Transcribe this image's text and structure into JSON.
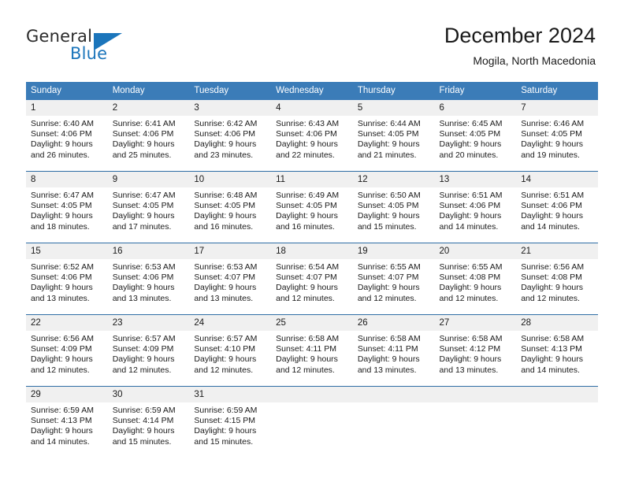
{
  "brand": {
    "name_part1": "General",
    "name_part2": "Blue",
    "logo_icon": "triangle-flag-icon",
    "accent_color": "#1b75bb"
  },
  "header": {
    "title": "December 2024",
    "subtitle": "Mogila, North Macedonia"
  },
  "theme": {
    "header_blue": "#3b7cb8",
    "row_border_blue": "#2f6ea5",
    "daynum_band": "#f0f0f0"
  },
  "calendar": {
    "weekdays": [
      "Sunday",
      "Monday",
      "Tuesday",
      "Wednesday",
      "Thursday",
      "Friday",
      "Saturday"
    ],
    "weeks": [
      [
        {
          "day": "1",
          "sunrise": "Sunrise: 6:40 AM",
          "sunset": "Sunset: 4:06 PM",
          "daylight1": "Daylight: 9 hours",
          "daylight2": "and 26 minutes."
        },
        {
          "day": "2",
          "sunrise": "Sunrise: 6:41 AM",
          "sunset": "Sunset: 4:06 PM",
          "daylight1": "Daylight: 9 hours",
          "daylight2": "and 25 minutes."
        },
        {
          "day": "3",
          "sunrise": "Sunrise: 6:42 AM",
          "sunset": "Sunset: 4:06 PM",
          "daylight1": "Daylight: 9 hours",
          "daylight2": "and 23 minutes."
        },
        {
          "day": "4",
          "sunrise": "Sunrise: 6:43 AM",
          "sunset": "Sunset: 4:06 PM",
          "daylight1": "Daylight: 9 hours",
          "daylight2": "and 22 minutes."
        },
        {
          "day": "5",
          "sunrise": "Sunrise: 6:44 AM",
          "sunset": "Sunset: 4:05 PM",
          "daylight1": "Daylight: 9 hours",
          "daylight2": "and 21 minutes."
        },
        {
          "day": "6",
          "sunrise": "Sunrise: 6:45 AM",
          "sunset": "Sunset: 4:05 PM",
          "daylight1": "Daylight: 9 hours",
          "daylight2": "and 20 minutes."
        },
        {
          "day": "7",
          "sunrise": "Sunrise: 6:46 AM",
          "sunset": "Sunset: 4:05 PM",
          "daylight1": "Daylight: 9 hours",
          "daylight2": "and 19 minutes."
        }
      ],
      [
        {
          "day": "8",
          "sunrise": "Sunrise: 6:47 AM",
          "sunset": "Sunset: 4:05 PM",
          "daylight1": "Daylight: 9 hours",
          "daylight2": "and 18 minutes."
        },
        {
          "day": "9",
          "sunrise": "Sunrise: 6:47 AM",
          "sunset": "Sunset: 4:05 PM",
          "daylight1": "Daylight: 9 hours",
          "daylight2": "and 17 minutes."
        },
        {
          "day": "10",
          "sunrise": "Sunrise: 6:48 AM",
          "sunset": "Sunset: 4:05 PM",
          "daylight1": "Daylight: 9 hours",
          "daylight2": "and 16 minutes."
        },
        {
          "day": "11",
          "sunrise": "Sunrise: 6:49 AM",
          "sunset": "Sunset: 4:05 PM",
          "daylight1": "Daylight: 9 hours",
          "daylight2": "and 16 minutes."
        },
        {
          "day": "12",
          "sunrise": "Sunrise: 6:50 AM",
          "sunset": "Sunset: 4:05 PM",
          "daylight1": "Daylight: 9 hours",
          "daylight2": "and 15 minutes."
        },
        {
          "day": "13",
          "sunrise": "Sunrise: 6:51 AM",
          "sunset": "Sunset: 4:06 PM",
          "daylight1": "Daylight: 9 hours",
          "daylight2": "and 14 minutes."
        },
        {
          "day": "14",
          "sunrise": "Sunrise: 6:51 AM",
          "sunset": "Sunset: 4:06 PM",
          "daylight1": "Daylight: 9 hours",
          "daylight2": "and 14 minutes."
        }
      ],
      [
        {
          "day": "15",
          "sunrise": "Sunrise: 6:52 AM",
          "sunset": "Sunset: 4:06 PM",
          "daylight1": "Daylight: 9 hours",
          "daylight2": "and 13 minutes."
        },
        {
          "day": "16",
          "sunrise": "Sunrise: 6:53 AM",
          "sunset": "Sunset: 4:06 PM",
          "daylight1": "Daylight: 9 hours",
          "daylight2": "and 13 minutes."
        },
        {
          "day": "17",
          "sunrise": "Sunrise: 6:53 AM",
          "sunset": "Sunset: 4:07 PM",
          "daylight1": "Daylight: 9 hours",
          "daylight2": "and 13 minutes."
        },
        {
          "day": "18",
          "sunrise": "Sunrise: 6:54 AM",
          "sunset": "Sunset: 4:07 PM",
          "daylight1": "Daylight: 9 hours",
          "daylight2": "and 12 minutes."
        },
        {
          "day": "19",
          "sunrise": "Sunrise: 6:55 AM",
          "sunset": "Sunset: 4:07 PM",
          "daylight1": "Daylight: 9 hours",
          "daylight2": "and 12 minutes."
        },
        {
          "day": "20",
          "sunrise": "Sunrise: 6:55 AM",
          "sunset": "Sunset: 4:08 PM",
          "daylight1": "Daylight: 9 hours",
          "daylight2": "and 12 minutes."
        },
        {
          "day": "21",
          "sunrise": "Sunrise: 6:56 AM",
          "sunset": "Sunset: 4:08 PM",
          "daylight1": "Daylight: 9 hours",
          "daylight2": "and 12 minutes."
        }
      ],
      [
        {
          "day": "22",
          "sunrise": "Sunrise: 6:56 AM",
          "sunset": "Sunset: 4:09 PM",
          "daylight1": "Daylight: 9 hours",
          "daylight2": "and 12 minutes."
        },
        {
          "day": "23",
          "sunrise": "Sunrise: 6:57 AM",
          "sunset": "Sunset: 4:09 PM",
          "daylight1": "Daylight: 9 hours",
          "daylight2": "and 12 minutes."
        },
        {
          "day": "24",
          "sunrise": "Sunrise: 6:57 AM",
          "sunset": "Sunset: 4:10 PM",
          "daylight1": "Daylight: 9 hours",
          "daylight2": "and 12 minutes."
        },
        {
          "day": "25",
          "sunrise": "Sunrise: 6:58 AM",
          "sunset": "Sunset: 4:11 PM",
          "daylight1": "Daylight: 9 hours",
          "daylight2": "and 12 minutes."
        },
        {
          "day": "26",
          "sunrise": "Sunrise: 6:58 AM",
          "sunset": "Sunset: 4:11 PM",
          "daylight1": "Daylight: 9 hours",
          "daylight2": "and 13 minutes."
        },
        {
          "day": "27",
          "sunrise": "Sunrise: 6:58 AM",
          "sunset": "Sunset: 4:12 PM",
          "daylight1": "Daylight: 9 hours",
          "daylight2": "and 13 minutes."
        },
        {
          "day": "28",
          "sunrise": "Sunrise: 6:58 AM",
          "sunset": "Sunset: 4:13 PM",
          "daylight1": "Daylight: 9 hours",
          "daylight2": "and 14 minutes."
        }
      ],
      [
        {
          "day": "29",
          "sunrise": "Sunrise: 6:59 AM",
          "sunset": "Sunset: 4:13 PM",
          "daylight1": "Daylight: 9 hours",
          "daylight2": "and 14 minutes."
        },
        {
          "day": "30",
          "sunrise": "Sunrise: 6:59 AM",
          "sunset": "Sunset: 4:14 PM",
          "daylight1": "Daylight: 9 hours",
          "daylight2": "and 15 minutes."
        },
        {
          "day": "31",
          "sunrise": "Sunrise: 6:59 AM",
          "sunset": "Sunset: 4:15 PM",
          "daylight1": "Daylight: 9 hours",
          "daylight2": "and 15 minutes."
        },
        {
          "day": "",
          "sunrise": "",
          "sunset": "",
          "daylight1": "",
          "daylight2": ""
        },
        {
          "day": "",
          "sunrise": "",
          "sunset": "",
          "daylight1": "",
          "daylight2": ""
        },
        {
          "day": "",
          "sunrise": "",
          "sunset": "",
          "daylight1": "",
          "daylight2": ""
        },
        {
          "day": "",
          "sunrise": "",
          "sunset": "",
          "daylight1": "",
          "daylight2": ""
        }
      ]
    ]
  }
}
